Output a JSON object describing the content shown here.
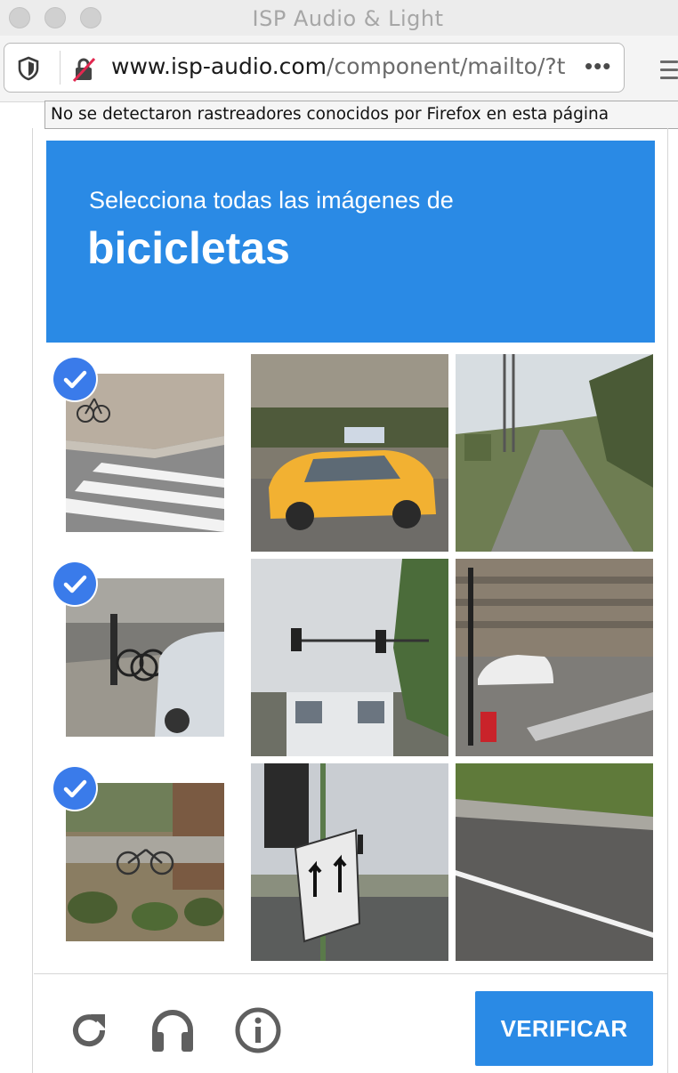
{
  "window": {
    "title": "ISP Audio & Light"
  },
  "urlbar": {
    "url_host": "www.isp-audio.com",
    "url_path": "/component/mailto/?t",
    "more_label": "•••",
    "shield_icon": "tracking-protection-shield-icon",
    "lock_icon": "insecure-lock-icon"
  },
  "tooltip": {
    "text": "No se detectaron rastreadores conocidos por Firefox en esta página"
  },
  "captcha": {
    "instruction": "Selecciona todas las imágenes de",
    "target": "bicicletas",
    "accent_color": "#2a8ae5",
    "tiles": [
      {
        "subject": "crosswalk with bicycle",
        "selected": true
      },
      {
        "subject": "yellow taxi",
        "selected": false
      },
      {
        "subject": "road with power lines",
        "selected": false
      },
      {
        "subject": "bicycles parked by white car",
        "selected": true
      },
      {
        "subject": "traffic lights and bus",
        "selected": false
      },
      {
        "subject": "intersection with building",
        "selected": false
      },
      {
        "subject": "bicycle in garden",
        "selected": true
      },
      {
        "subject": "traffic light with arrow sign",
        "selected": false
      },
      {
        "subject": "grass roadside",
        "selected": false
      }
    ],
    "footer": {
      "reload_icon": "reload-icon",
      "audio_icon": "headphones-icon",
      "info_icon": "info-icon",
      "verify_label": "VERIFICAR"
    }
  }
}
